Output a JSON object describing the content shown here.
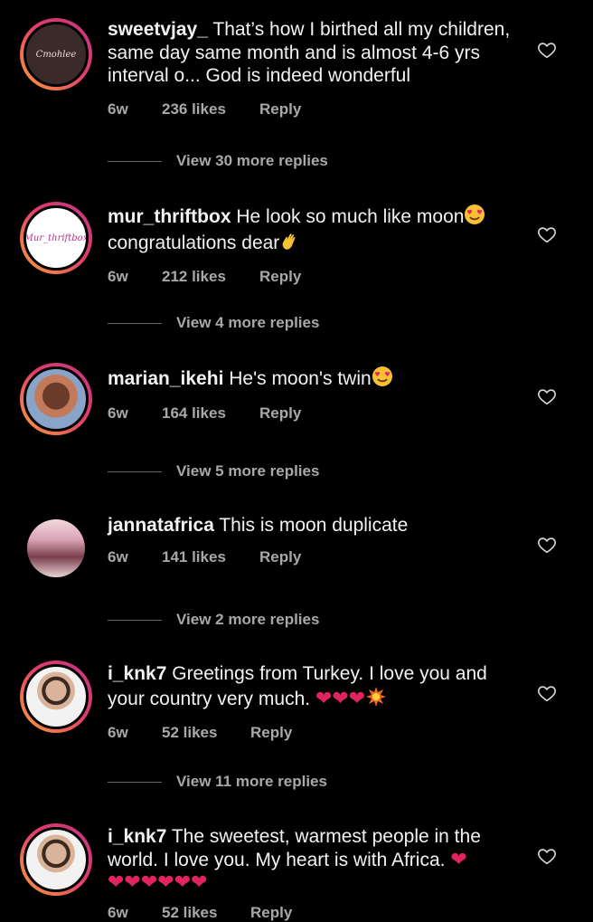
{
  "comments": [
    {
      "username": "sweetvjay_",
      "text": "That’s how I birthed all my children, same day same month and is almost 4-6 yrs interval o... God is indeed wonderful",
      "time": "6w",
      "likes": "236 likes",
      "reply_label": "Reply",
      "view_replies": "View 30 more replies",
      "avatar_text": "Cmohlee"
    },
    {
      "username": "mur_thriftbox",
      "text": "He look so much like moon",
      "text2": "congratulations dear",
      "time": "6w",
      "likes": "212 likes",
      "reply_label": "Reply",
      "view_replies": "View 4 more replies",
      "avatar_text": "Mur_thriftbox"
    },
    {
      "username": "marian_ikehi",
      "text": "He's moon's twin",
      "time": "6w",
      "likes": "164 likes",
      "reply_label": "Reply",
      "view_replies": "View 5 more replies"
    },
    {
      "username": "jannatafrica",
      "text": "This is moon duplicate",
      "time": "6w",
      "likes": "141 likes",
      "reply_label": "Reply",
      "view_replies": "View 2 more replies"
    },
    {
      "username": "i_knk7",
      "text": "Greetings from Turkey. I love you and your country very much.",
      "time": "6w",
      "likes": "52 likes",
      "reply_label": "Reply",
      "view_replies": "View 11 more replies"
    },
    {
      "username": "i_knk7",
      "text": "The sweetest, warmest people in the world. I love you. My heart is with Africa.",
      "time": "6w",
      "likes": "52 likes",
      "reply_label": "Reply"
    }
  ],
  "colors": {
    "background": "#000000",
    "text": "#f2f2f2",
    "muted": "#a8a8a8",
    "heart": "#e0245e"
  },
  "icons": {
    "like": "heart-outline-icon",
    "emoji_heart": "red-heart",
    "emoji_love": "heart-eyes",
    "emoji_wave": "waving-hand",
    "emoji_burst": "collision"
  }
}
